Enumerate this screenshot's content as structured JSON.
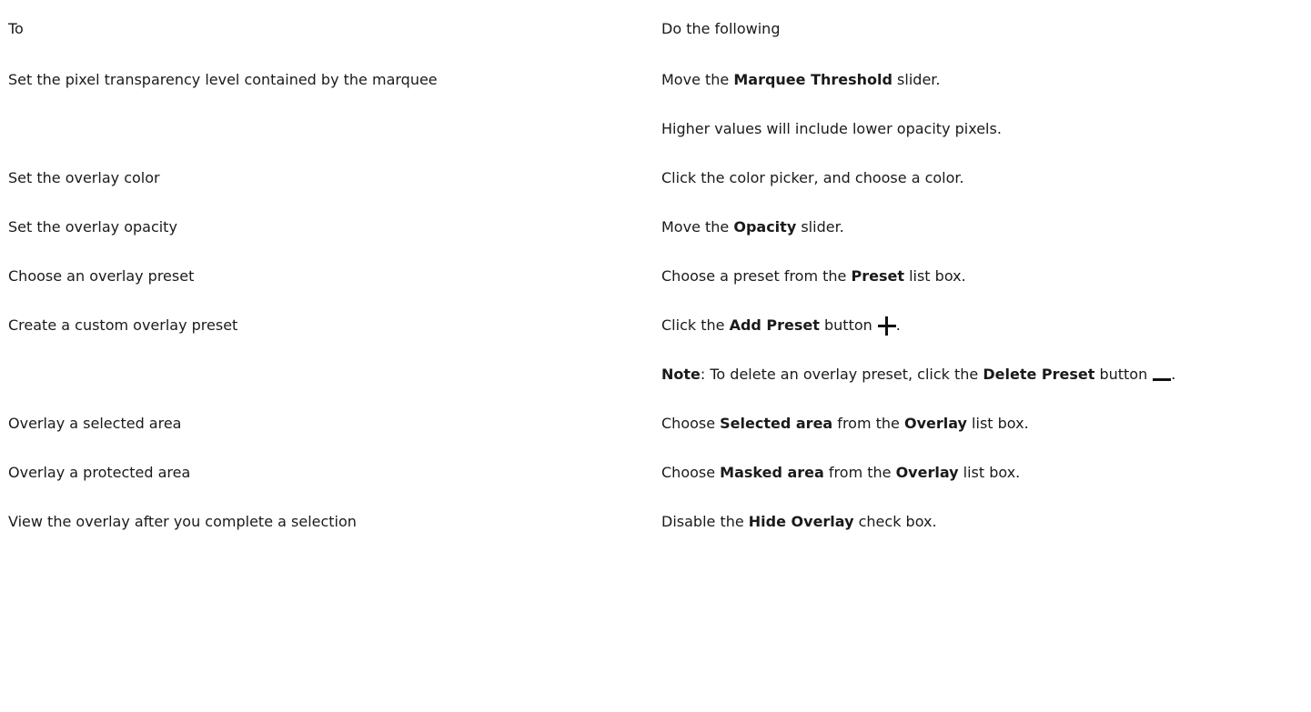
{
  "header": {
    "col_to": "To",
    "col_do": "Do the following"
  },
  "rows": [
    {
      "to": "Set the pixel transparency level contained by the marquee",
      "do_pre": "Move the ",
      "do_bold": "Marquee Threshold",
      "do_post": " slider.",
      "extra": "Higher values will include lower opacity pixels."
    },
    {
      "to": "Set the overlay color",
      "do": "Click the color picker, and choose a color."
    },
    {
      "to": "Set the overlay opacity",
      "do_pre": "Move the ",
      "do_bold": "Opacity",
      "do_post": " slider."
    },
    {
      "to": "Choose an overlay preset",
      "do_pre": "Choose a preset from the ",
      "do_bold": "Preset",
      "do_post": " list box."
    },
    {
      "to": "Create a custom overlay preset",
      "do_pre": "Click the ",
      "do_bold": "Add Preset",
      "do_post": " button",
      "do_end": ".",
      "icon": "plus-icon",
      "note_label": "Note",
      "note_pre": ": To delete an overlay preset, click the ",
      "note_bold": "Delete Preset",
      "note_post": " button",
      "note_end": ".",
      "note_icon": "minus-icon"
    },
    {
      "to": "Overlay a selected area",
      "do_pre": "Choose ",
      "do_bold": "Selected area",
      "do_mid": " from the ",
      "do_bold2": "Overlay",
      "do_post": " list box."
    },
    {
      "to": "Overlay a protected area",
      "do_pre": "Choose ",
      "do_bold": "Masked area",
      "do_mid": " from the ",
      "do_bold2": "Overlay",
      "do_post": " list box."
    },
    {
      "to": "View the overlay after you complete a selection",
      "do_pre": "Disable the ",
      "do_bold": "Hide Overlay",
      "do_post": " check box."
    }
  ]
}
